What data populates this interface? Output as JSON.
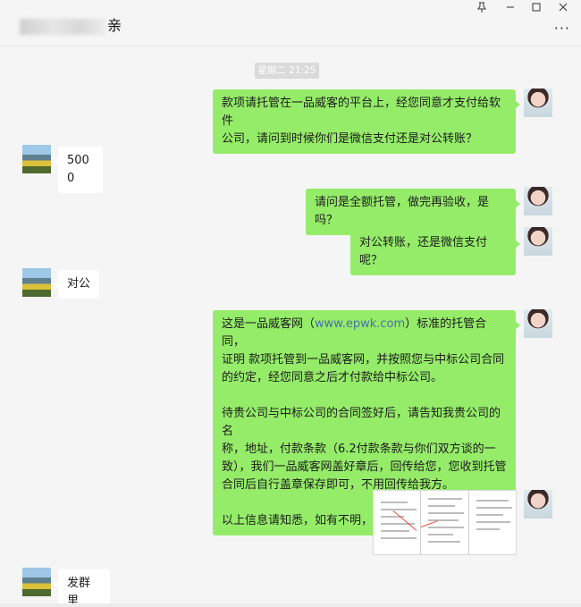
{
  "window": {
    "title_suffix": "亲",
    "pin_icon": "pin-icon",
    "minimize_icon": "minimize-icon",
    "maximize_icon": "maximize-icon",
    "close_icon": "close-icon",
    "more_icon": "more-icon"
  },
  "timestamp": "星期二 21:25",
  "messages": [
    {
      "from": "me",
      "text": "款项请托管在一品威客的平台上，经您同意才支付给软件\n公司，请问到时候你们是微信支付还是对公转账？"
    },
    {
      "from": "them",
      "text": "5000"
    },
    {
      "from": "me",
      "text": "请问是全额托管，做完再验收，是吗？"
    },
    {
      "from": "me",
      "text": "对公转账，还是微信支付呢？"
    },
    {
      "from": "them",
      "text": "对公"
    },
    {
      "from": "me",
      "link_prefix": "这是一品威客网（",
      "link": "www.epwk.com",
      "link_suffix": "）标准的托管合同，\n证明 款项托管到一品威客网，并按照您与中标公司合同\n的约定，经您同意之后才付款给中标公司。\n\n待贵公司与中标公司的合同签好后，请告知我贵公司的名\n称，地址，付款条款（6.2付款条款与你们双方谈的一\n致），我们一品威客网盖好章后，回传给您，您收到托管\n合同后自行盖章保存即可，不用回传给我方。\n\n以上信息请知悉，如有不明，可随时沟通。"
    },
    {
      "from": "me",
      "type": "image"
    },
    {
      "from": "them",
      "text": "发群里"
    }
  ],
  "colors": {
    "my_bubble": "#95ec69",
    "their_bubble": "#ffffff",
    "background": "#f5f5f5",
    "link": "#4a6ea9"
  }
}
